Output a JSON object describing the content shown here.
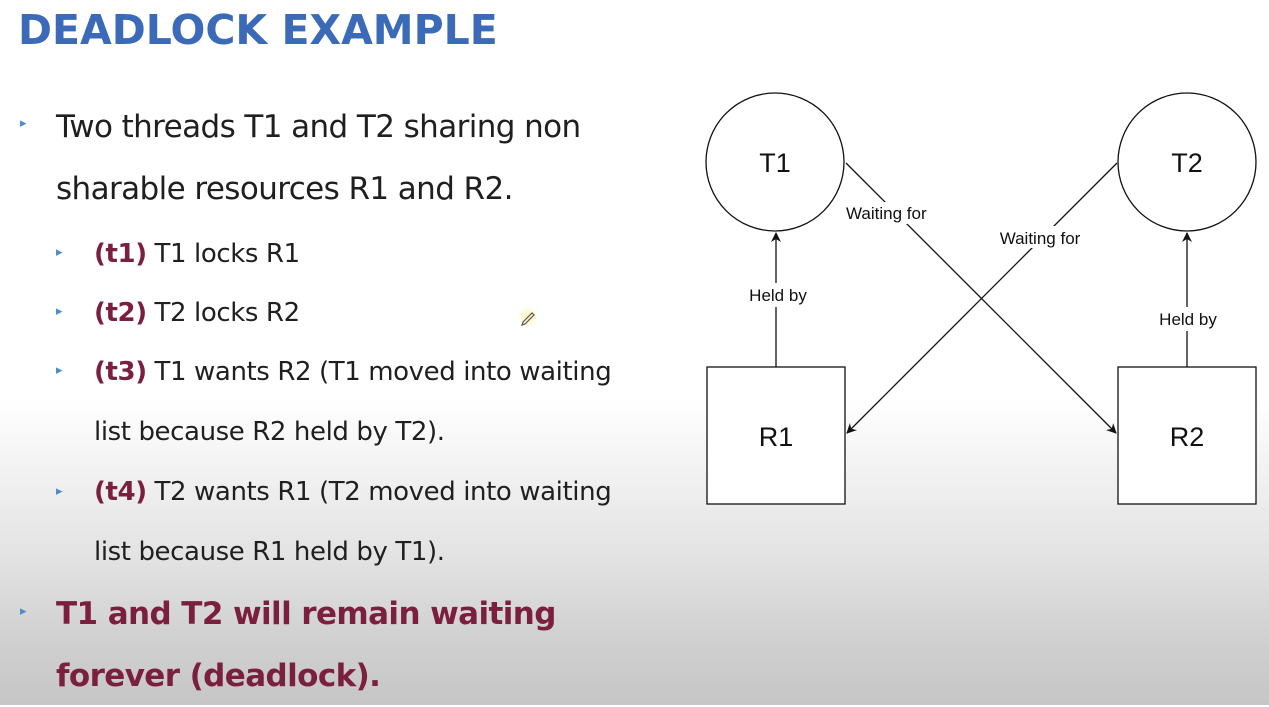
{
  "slide": {
    "title": "DEADLOCK EXAMPLE",
    "bullets": {
      "b1_line1": "Two threads T1 and T2 sharing non",
      "b1_line2": "sharable resources R1 and R2.",
      "t1_label": "(t1)",
      "t1_text": " T1 locks R1",
      "t2_label": "(t2)",
      "t2_text": " T2 locks R2",
      "t3_label": "(t3)",
      "t3_text_line1": " T1 wants R2 (T1 moved into waiting",
      "t3_text_line2": "list because R2 held by T2).",
      "t4_label": "(t4)",
      "t4_text_line1": " T2 wants R1 (T2 moved into waiting",
      "t4_text_line2": "list because R1 held by T1).",
      "conclusion_line1": "T1 and T2 will remain waiting",
      "conclusion_line2": "forever (deadlock)."
    }
  },
  "diagram": {
    "nodes": {
      "t1": "T1",
      "t2": "T2",
      "r1": "R1",
      "r2": "R2"
    },
    "edges": {
      "r1_to_t1": "Held by",
      "r2_to_t2": "Held by",
      "t1_to_r2": "Waiting for",
      "t2_to_r1": "Waiting for"
    }
  },
  "colors": {
    "title": "#3B6BB8",
    "emphasis": "#7A1F3D",
    "bullet_marker": "#4A8ECB"
  },
  "icons": {
    "bullet": "triangle-bullet-icon",
    "cursor": "pencil-cursor-icon"
  }
}
